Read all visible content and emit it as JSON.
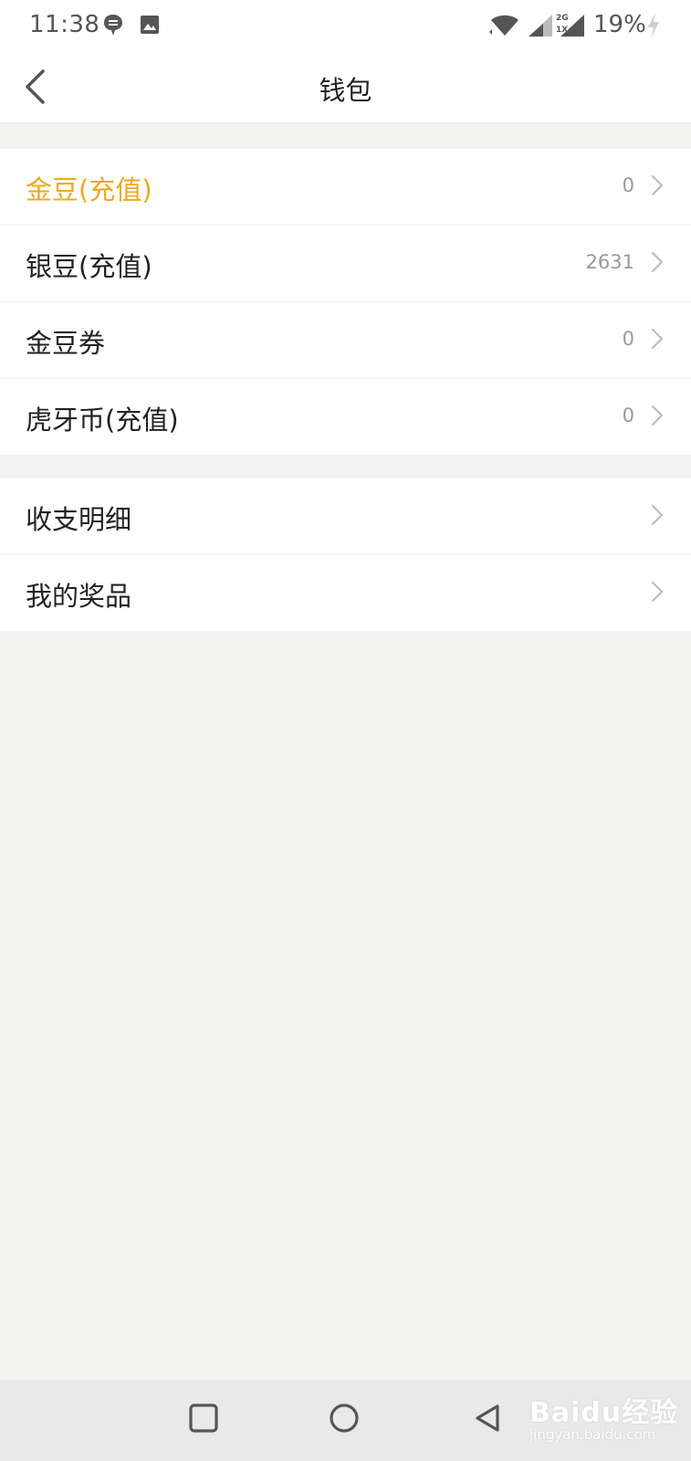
{
  "status_bar": {
    "time": "11:38",
    "battery": "19%",
    "icons": [
      "chat-bubble-icon",
      "image-icon",
      "wifi-icon",
      "signal-icon",
      "signal-2g-icon",
      "charging-icon"
    ],
    "network_labels": [
      "2G",
      "1X"
    ]
  },
  "header": {
    "title": "钱包",
    "back_icon": "chevron-left-icon"
  },
  "wallet": {
    "items": [
      {
        "label": "金豆(充值)",
        "value": "0",
        "accent": true
      },
      {
        "label": "银豆(充值)",
        "value": "2631"
      },
      {
        "label": "金豆券",
        "value": "0"
      },
      {
        "label": "虎牙币(充值)",
        "value": "0"
      }
    ]
  },
  "records": {
    "items": [
      {
        "label": "收支明细"
      },
      {
        "label": "我的奖品"
      }
    ]
  },
  "nav_bar": {
    "buttons": [
      "recent-apps-icon",
      "home-icon",
      "back-icon"
    ]
  },
  "watermark": {
    "text": "Baidu经验",
    "sub": "jingyan.baidu.com"
  },
  "colors": {
    "accent": "#f0a81e",
    "background": "#f3f3f2",
    "text": "#222222",
    "muted": "#9a9a9a"
  }
}
